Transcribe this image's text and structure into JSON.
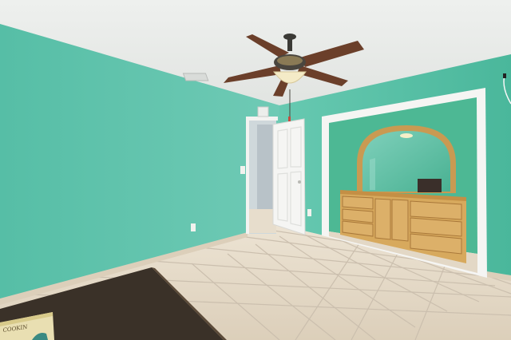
{
  "scene": {
    "description_label": "",
    "book_cover_text": "COOKIN"
  },
  "colors": {
    "ceiling": "#e6e8e6",
    "wall_left": "#5fc4ad",
    "wall_right": "#55bfa4",
    "alcove_wall": "#4fb896",
    "floor_tile": "#e3d7c5",
    "grout": "#cbbfae",
    "door": "#f4f4f2",
    "dresser_wood": "#d6a85c",
    "dresser_dark": "#a9783a",
    "fan_blade": "#6b3f2a",
    "fan_metal": "#3b3a36",
    "table_top": "#3a3128",
    "baseboard": "#d9cdb8"
  }
}
